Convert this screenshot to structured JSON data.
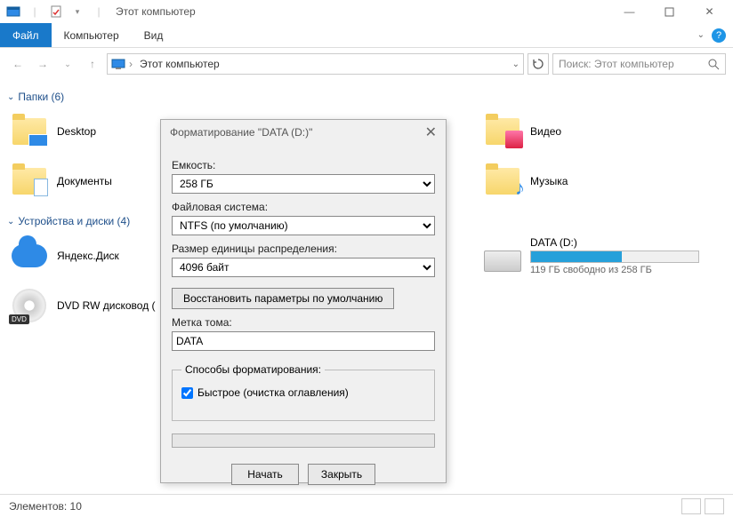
{
  "titlebar": {
    "title": "Этот компьютер"
  },
  "menu": {
    "file": "Файл",
    "computer": "Компьютер",
    "view": "Вид"
  },
  "address": {
    "crumb": "Этот компьютер"
  },
  "search": {
    "placeholder": "Поиск: Этот компьютер"
  },
  "sections": {
    "folders": {
      "label": "Папки (6)"
    },
    "devices": {
      "label": "Устройства и диски (4)"
    }
  },
  "folders": {
    "desktop": "Desktop",
    "documents": "Документы",
    "video": "Видео",
    "music": "Музыка"
  },
  "devices": {
    "yadisk": "Яндекс.Диск",
    "dvd": "DVD RW дисковод (",
    "data_name": "DATA (D:)",
    "data_free": "119 ГБ свободно из 258 ГБ",
    "data_fill_pct": 54
  },
  "dialog": {
    "title": "Форматирование \"DATA (D:)\"",
    "capacity_lbl": "Емкость:",
    "capacity_val": "258 ГБ",
    "fs_lbl": "Файловая система:",
    "fs_val": "NTFS (по умолчанию)",
    "alloc_lbl": "Размер единицы распределения:",
    "alloc_val": "4096 байт",
    "restore": "Восстановить параметры по умолчанию",
    "volume_lbl": "Метка тома:",
    "volume_val": "DATA",
    "ways_lbl": "Способы форматирования:",
    "quick": "Быстрое (очистка оглавления)",
    "start": "Начать",
    "close": "Закрыть"
  },
  "status": {
    "elements": "Элементов: 10"
  }
}
